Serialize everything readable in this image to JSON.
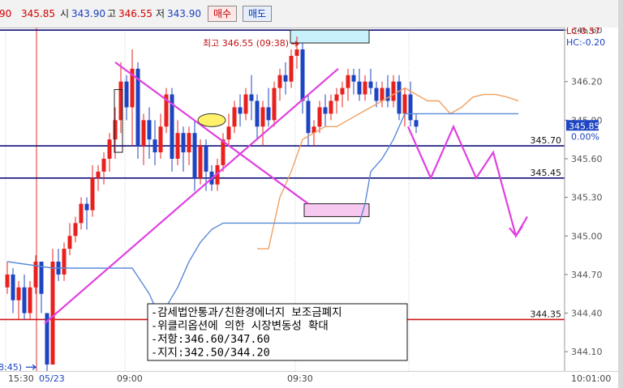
{
  "toolbar": {
    "prev_value": "90",
    "current_value": "345.85",
    "open_label": "시",
    "open_value": "343.90",
    "high_label": "고",
    "high_value": "346.55",
    "low_label": "저",
    "low_value": "343.90",
    "buy_button": "매수",
    "sell_button": "매도"
  },
  "chart_labels": {
    "high_marker": "최고 346.55 (09:38)",
    "low_marker": "8:45)",
    "lc": "LC:0.57",
    "hc": "HC:-0.20",
    "price_now": "345.85",
    "pct_now": "0.00%",
    "date": "05/23",
    "time_left": "15:30",
    "time_clock": "10:01:00"
  },
  "annotation_box": {
    "lines": [
      "-감세법안통과/친환경에너지 보조금폐지",
      "-위클리옵션에 의한 시장변동성 확대",
      "-저항:346.60/347.60",
      "-지지:342.50/344.20"
    ]
  },
  "colors": {
    "up_candle": "#e8211e",
    "down_candle": "#1d44c2",
    "orange_line": "#f0a060",
    "blue_line": "#5b8ad8",
    "magenta": "#e040e0",
    "hline_blue": "#10107a",
    "hline_red": "#d01515"
  },
  "chart_data": {
    "type": "candlestick",
    "y_range": [
      343.95,
      346.62
    ],
    "y_ticks": [
      346.6,
      346.2,
      345.9,
      345.6,
      345.3,
      345.0,
      344.7,
      344.4,
      344.1
    ],
    "y_tick_labels": [
      "346.60",
      "346.20",
      "345.90",
      "345.60",
      "345.30",
      "345.00",
      "344.70",
      "344.40",
      "344.10"
    ],
    "x_labels": [
      {
        "label": "09:00",
        "index": 21
      },
      {
        "label": "09:30",
        "index": 51
      }
    ],
    "hlines": [
      {
        "value": 346.6,
        "label": "346.60",
        "color": "#10107a"
      },
      {
        "value": 345.7,
        "label": "345.70",
        "color": "#10107a"
      },
      {
        "value": 345.45,
        "label": "345.45",
        "color": "#10107a"
      },
      {
        "value": 344.35,
        "label": "344.35",
        "color": "#d01515"
      }
    ],
    "candles": [
      [
        344.6,
        344.8,
        344.55,
        344.7
      ],
      [
        344.7,
        344.75,
        344.4,
        344.5
      ],
      [
        344.5,
        344.65,
        344.35,
        344.6
      ],
      [
        344.6,
        344.7,
        344.35,
        344.4
      ],
      [
        344.4,
        344.65,
        344.35,
        344.6
      ],
      [
        344.6,
        344.85,
        344.55,
        344.8
      ],
      [
        344.8,
        344.8,
        344.4,
        344.55
      ],
      [
        344.4,
        344.4,
        343.95,
        344.0
      ],
      [
        344.0,
        344.9,
        344.0,
        344.8
      ],
      [
        344.8,
        344.9,
        344.65,
        344.7
      ],
      [
        344.7,
        344.95,
        344.65,
        344.9
      ],
      [
        344.9,
        345.1,
        344.85,
        345.0
      ],
      [
        345.0,
        345.15,
        344.95,
        345.1
      ],
      [
        345.1,
        345.3,
        345.05,
        345.25
      ],
      [
        345.25,
        345.3,
        345.05,
        345.2
      ],
      [
        345.2,
        345.55,
        345.15,
        345.45
      ],
      [
        345.45,
        345.55,
        345.35,
        345.5
      ],
      [
        345.5,
        345.65,
        345.4,
        345.6
      ],
      [
        345.6,
        345.8,
        345.5,
        345.75
      ],
      [
        345.75,
        346.0,
        345.6,
        345.9
      ],
      [
        345.9,
        346.35,
        345.8,
        346.2
      ],
      [
        346.2,
        346.25,
        345.9,
        346.0
      ],
      [
        346.0,
        346.45,
        345.7,
        346.3
      ],
      [
        346.3,
        346.35,
        345.6,
        345.7
      ],
      [
        345.7,
        345.95,
        345.55,
        345.9
      ],
      [
        345.9,
        346.0,
        345.6,
        345.75
      ],
      [
        345.75,
        345.9,
        345.55,
        345.65
      ],
      [
        345.65,
        345.95,
        345.6,
        345.85
      ],
      [
        345.85,
        346.15,
        345.8,
        346.1
      ],
      [
        346.1,
        346.15,
        345.5,
        345.6
      ],
      [
        345.6,
        345.9,
        345.55,
        345.8
      ],
      [
        345.8,
        345.85,
        345.5,
        345.65
      ],
      [
        345.65,
        345.85,
        345.55,
        345.8
      ],
      [
        345.8,
        345.9,
        345.35,
        345.45
      ],
      [
        345.45,
        345.75,
        345.4,
        345.7
      ],
      [
        345.7,
        345.75,
        345.35,
        345.5
      ],
      [
        345.5,
        345.55,
        345.35,
        345.4
      ],
      [
        345.4,
        345.6,
        345.35,
        345.55
      ],
      [
        345.55,
        345.8,
        345.5,
        345.75
      ],
      [
        345.75,
        345.95,
        345.7,
        345.85
      ],
      [
        345.85,
        346.05,
        345.8,
        346.0
      ],
      [
        346.0,
        346.1,
        345.85,
        345.95
      ],
      [
        345.95,
        346.15,
        345.9,
        346.1
      ],
      [
        346.1,
        346.25,
        345.9,
        346.05
      ],
      [
        346.05,
        346.1,
        345.75,
        345.85
      ],
      [
        345.85,
        346.05,
        345.7,
        346.0
      ],
      [
        346.0,
        346.15,
        345.85,
        345.9
      ],
      [
        345.9,
        346.2,
        345.85,
        346.15
      ],
      [
        346.15,
        346.3,
        346.05,
        346.25
      ],
      [
        346.25,
        346.35,
        346.1,
        346.2
      ],
      [
        346.2,
        346.45,
        346.15,
        346.4
      ],
      [
        346.4,
        346.55,
        346.3,
        346.45
      ],
      [
        346.45,
        346.5,
        345.95,
        346.05
      ],
      [
        346.05,
        346.1,
        345.7,
        345.8
      ],
      [
        345.8,
        345.9,
        345.7,
        345.85
      ],
      [
        345.85,
        346.05,
        345.8,
        346.0
      ],
      [
        346.0,
        346.1,
        345.85,
        345.95
      ],
      [
        345.95,
        346.1,
        345.9,
        346.05
      ],
      [
        346.05,
        346.15,
        345.95,
        346.1
      ],
      [
        346.1,
        346.2,
        346.0,
        346.15
      ],
      [
        346.15,
        346.3,
        346.05,
        346.25
      ],
      [
        346.25,
        346.3,
        346.1,
        346.2
      ],
      [
        346.2,
        346.3,
        346.05,
        346.1
      ],
      [
        346.1,
        346.25,
        346.05,
        346.2
      ],
      [
        346.2,
        346.3,
        346.1,
        346.15
      ],
      [
        346.15,
        346.2,
        346.0,
        346.05
      ],
      [
        346.05,
        346.2,
        346.0,
        346.15
      ],
      [
        346.15,
        346.25,
        346.0,
        346.05
      ],
      [
        346.05,
        346.25,
        346.0,
        346.2
      ],
      [
        346.2,
        346.25,
        345.9,
        345.95
      ],
      [
        345.95,
        346.15,
        345.85,
        346.1
      ],
      [
        346.1,
        346.2,
        345.85,
        345.9
      ],
      [
        345.9,
        345.95,
        345.8,
        345.85
      ]
    ],
    "orange_line": [
      [
        44,
        344.9
      ],
      [
        46,
        344.9
      ],
      [
        48,
        345.3
      ],
      [
        50,
        345.5
      ],
      [
        52,
        345.75
      ],
      [
        54,
        345.8
      ],
      [
        56,
        345.85
      ],
      [
        58,
        345.85
      ],
      [
        60,
        345.9
      ],
      [
        62,
        345.95
      ],
      [
        64,
        346.0
      ],
      [
        66,
        346.05
      ],
      [
        68,
        346.1
      ],
      [
        70,
        346.15
      ],
      [
        72,
        346.1
      ],
      [
        74,
        346.05
      ],
      [
        76,
        346.05
      ],
      [
        78,
        345.95
      ],
      [
        80,
        346.0
      ],
      [
        82,
        346.08
      ],
      [
        84,
        346.1
      ],
      [
        86,
        346.1
      ],
      [
        88,
        346.08
      ],
      [
        90,
        346.05
      ]
    ],
    "blue_line": [
      [
        0,
        344.8
      ],
      [
        8,
        344.75
      ],
      [
        16,
        344.75
      ],
      [
        22,
        344.75
      ],
      [
        25,
        344.55
      ],
      [
        26,
        344.45
      ],
      [
        28,
        344.45
      ],
      [
        30,
        344.6
      ],
      [
        32,
        344.8
      ],
      [
        34,
        344.95
      ],
      [
        36,
        345.05
      ],
      [
        38,
        345.1
      ],
      [
        44,
        345.1
      ],
      [
        52,
        345.1
      ],
      [
        62,
        345.1
      ],
      [
        63,
        345.25
      ],
      [
        64,
        345.5
      ],
      [
        66,
        345.6
      ],
      [
        68,
        345.75
      ],
      [
        70,
        345.95
      ],
      [
        74,
        345.95
      ],
      [
        84,
        345.95
      ],
      [
        90,
        345.95
      ]
    ],
    "triangle": [
      [
        19,
        346.35
      ],
      [
        47,
        345.25
      ],
      [
        34,
        345.2
      ],
      [
        52,
        346.3
      ]
    ],
    "forecast": [
      [
        63,
        345.85
      ],
      [
        67,
        345.45
      ],
      [
        71,
        345.85
      ],
      [
        75,
        345.45
      ],
      [
        78,
        345.65
      ],
      [
        82,
        345.0
      ],
      [
        84,
        345.15
      ]
    ],
    "ellipse_center": [
      32,
      345.9
    ],
    "resistance_box": [
      45,
      346.5,
      64,
      346.6
    ],
    "support_box": [
      46,
      345.15,
      64,
      345.25
    ],
    "marker_box": [
      17,
      345.65,
      18,
      346.1
    ]
  }
}
